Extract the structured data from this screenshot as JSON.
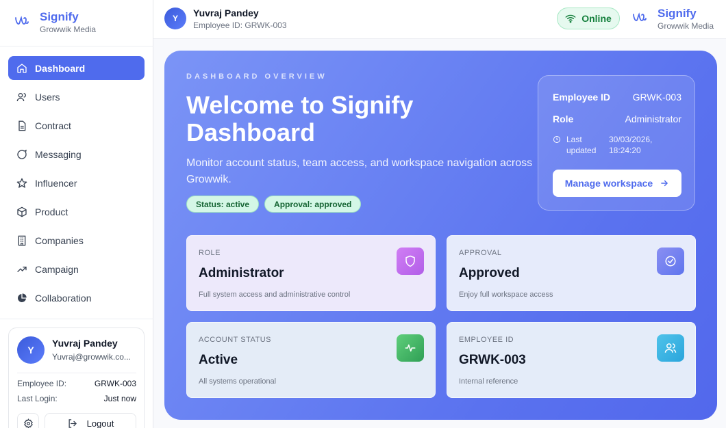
{
  "brand": {
    "name": "Signify",
    "org": "Growwik Media"
  },
  "sidebar": {
    "items": [
      {
        "label": "Dashboard",
        "icon": "home-icon",
        "active": true
      },
      {
        "label": "Users",
        "icon": "users-icon"
      },
      {
        "label": "Contract",
        "icon": "document-icon"
      },
      {
        "label": "Messaging",
        "icon": "chat-icon"
      },
      {
        "label": "Influencer",
        "icon": "star-icon"
      },
      {
        "label": "Product",
        "icon": "box-icon"
      },
      {
        "label": "Companies",
        "icon": "building-icon"
      },
      {
        "label": "Campaign",
        "icon": "trend-icon"
      },
      {
        "label": "Collaboration",
        "icon": "pie-icon"
      }
    ]
  },
  "user": {
    "initial": "Y",
    "name": "Yuvraj Pandey",
    "email": "Yuvraj@growwik.co...",
    "employee_id_label": "Employee ID:",
    "employee_id": "GRWK-003",
    "last_login_label": "Last Login:",
    "last_login": "Just now",
    "logout_label": "Logout"
  },
  "header": {
    "initial": "Y",
    "name": "Yuvraj Pandey",
    "employee_line": "Employee ID: GRWK-003",
    "status": "Online"
  },
  "hero": {
    "kicker": "DASHBOARD OVERVIEW",
    "title": "Welcome to Signify Dashboard",
    "description": "Monitor account status, team access, and workspace navigation across Growwik.",
    "badges": [
      "Status: active",
      "Approval: approved"
    ],
    "info": {
      "employee_id_label": "Employee ID",
      "employee_id": "GRWK-003",
      "role_label": "Role",
      "role": "Administrator",
      "last_updated_label": "Last updated",
      "last_updated": "30/03/2026, 18:24:20",
      "button": "Manage workspace"
    }
  },
  "stats": [
    {
      "label": "ROLE",
      "value": "Administrator",
      "desc": "Full system access and administrative control",
      "icon": "shield-icon",
      "color": "#c06ef0"
    },
    {
      "label": "APPROVAL",
      "value": "Approved",
      "desc": "Enjoy full workspace access",
      "icon": "check-circle-icon",
      "color": "#6f7ff0"
    },
    {
      "label": "ACCOUNT STATUS",
      "value": "Active",
      "desc": "All systems operational",
      "icon": "activity-icon",
      "color": "#47b96a"
    },
    {
      "label": "EMPLOYEE ID",
      "value": "GRWK-003",
      "desc": "Internal reference",
      "icon": "team-icon",
      "color": "#3cb6e6"
    }
  ]
}
